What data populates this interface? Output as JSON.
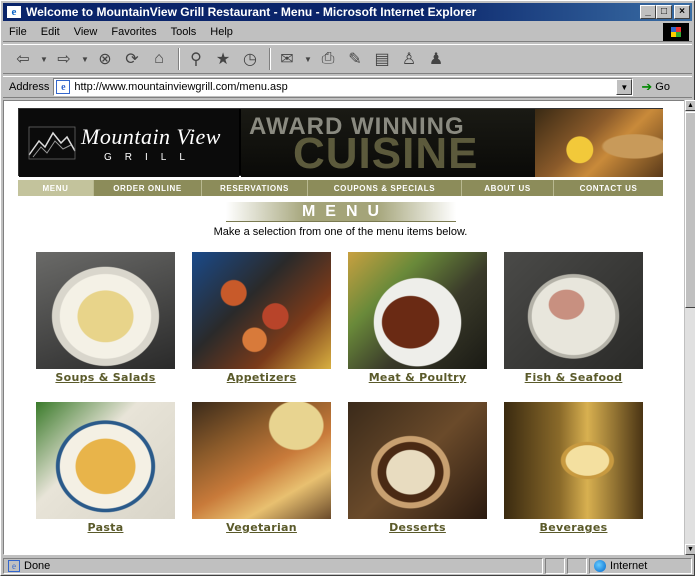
{
  "window": {
    "title": "Welcome to MountainView Grill Restaurant - Menu - Microsoft Internet Explorer",
    "minimize_glyph": "_",
    "maximize_glyph": "□",
    "close_glyph": "×"
  },
  "menubar": {
    "items": [
      {
        "label": "File"
      },
      {
        "label": "Edit"
      },
      {
        "label": "View"
      },
      {
        "label": "Favorites"
      },
      {
        "label": "Tools"
      },
      {
        "label": "Help"
      }
    ]
  },
  "toolbar": {
    "buttons": [
      {
        "name": "back",
        "glyph": "⇦"
      },
      {
        "name": "forward",
        "glyph": "⇨"
      },
      {
        "name": "stop",
        "glyph": "⊗"
      },
      {
        "name": "refresh",
        "glyph": "⟳"
      },
      {
        "name": "home",
        "glyph": "⌂"
      },
      {
        "name": "search",
        "glyph": "⚲"
      },
      {
        "name": "favorites",
        "glyph": "★"
      },
      {
        "name": "history",
        "glyph": "◷"
      },
      {
        "name": "mail",
        "glyph": "✉"
      },
      {
        "name": "print",
        "glyph": "⎙"
      },
      {
        "name": "edit",
        "glyph": "✎"
      },
      {
        "name": "discuss",
        "glyph": "▤"
      },
      {
        "name": "messenger",
        "glyph": "♙"
      },
      {
        "name": "user",
        "glyph": "♟"
      }
    ]
  },
  "addressbar": {
    "label": "Address",
    "url": "http://www.mountainviewgrill.com/menu.asp",
    "go_label": "Go"
  },
  "site": {
    "logo": {
      "line1": "Mountain View",
      "line2": "GRILL"
    },
    "banner": {
      "line1": "AWARD WINNING",
      "line2": "CUISINE"
    },
    "nav": [
      {
        "label": "MENU",
        "active": true
      },
      {
        "label": "ORDER ONLINE"
      },
      {
        "label": "RESERVATIONS"
      },
      {
        "label": "COUPONS & SPECIALS"
      },
      {
        "label": "ABOUT US"
      },
      {
        "label": "CONTACT US"
      }
    ],
    "heading": "MENU",
    "subtitle": "Make a selection from one of the menu items below.",
    "items": [
      {
        "label": "Soups & Salads"
      },
      {
        "label": "Appetizers"
      },
      {
        "label": "Meat & Poultry"
      },
      {
        "label": "Fish & Seafood"
      },
      {
        "label": "Pasta"
      },
      {
        "label": "Vegetarian"
      },
      {
        "label": "Desserts"
      },
      {
        "label": "Beverages"
      }
    ]
  },
  "statusbar": {
    "status": "Done",
    "zone": "Internet"
  },
  "colors": {
    "titlebar": "#0a246a",
    "nav_bg": "#8c8c5a",
    "nav_active": "#c3c39c",
    "link": "#5a5a2a"
  }
}
